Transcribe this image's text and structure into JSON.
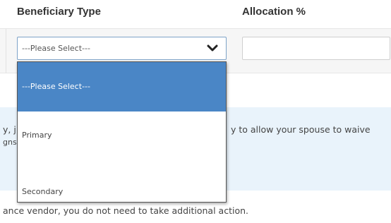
{
  "table": {
    "headers": {
      "beneficiary_type": "Beneficiary Type",
      "allocation": "Allocation %"
    },
    "row": {
      "type_select": {
        "selected": "---Please Select---",
        "icon": "chevron-down-icon",
        "options": [
          "---Please Select---",
          "Primary",
          "Secondary"
        ]
      },
      "allocation_value": ""
    }
  },
  "info_panel": {
    "line1_left": "y, j",
    "line1_right": "y to allow your spouse to waive",
    "line2": "gns",
    "line3": "ance vendor, you do not need to take additional action."
  },
  "colors": {
    "highlight": "#4a86c6",
    "info_background": "#e9f3fb",
    "focus_border": "#7ea3c8"
  }
}
